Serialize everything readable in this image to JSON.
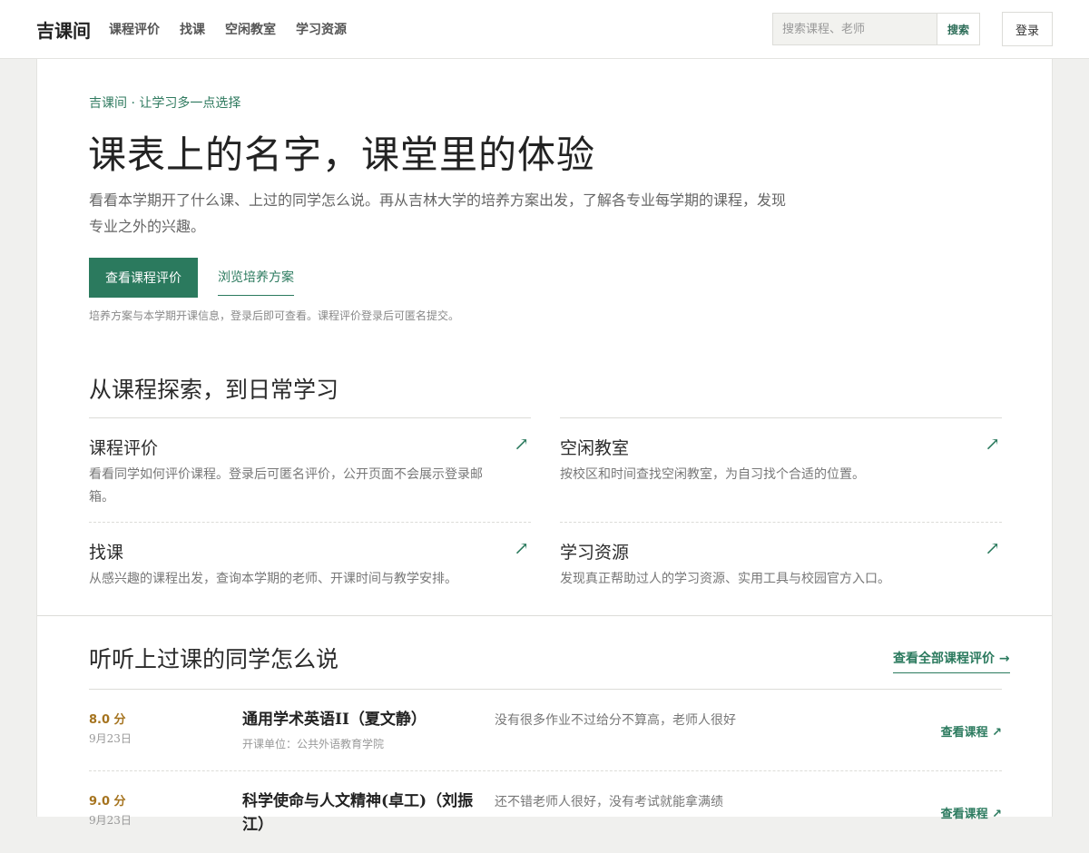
{
  "header": {
    "logo": "吉课间",
    "nav": [
      "课程评价",
      "找课",
      "空闲教室",
      "学习资源"
    ],
    "search_placeholder": "搜索课程、老师",
    "search_button": "搜索",
    "login": "登录"
  },
  "hero": {
    "eyebrow": "吉课间 · 让学习多一点选择",
    "title": "课表上的名字，课堂里的体验",
    "desc": "看看本学期开了什么课、上过的同学怎么说。再从吉林大学的培养方案出发，了解各专业每学期的课程，发现专业之外的兴趣。",
    "primary_button": "查看课程评价",
    "secondary_link": "浏览培养方案",
    "note": "培养方案与本学期开课信息，登录后即可查看。课程评价登录后可匿名提交。"
  },
  "explore": {
    "title": "从课程探索，到日常学习",
    "features": [
      {
        "title": "课程评价",
        "desc": "看看同学如何评价课程。登录后可匿名评价，公开页面不会展示登录邮箱。",
        "arrow": "↗"
      },
      {
        "title": "空闲教室",
        "desc": "按校区和时间查找空闲教室，为自习找个合适的位置。",
        "arrow": "↗"
      },
      {
        "title": "找课",
        "desc": "从感兴趣的课程出发，查询本学期的老师、开课时间与教学安排。",
        "arrow": "↗"
      },
      {
        "title": "学习资源",
        "desc": "发现真正帮助过人的学习资源、实用工具与校园官方入口。",
        "arrow": "↗"
      }
    ]
  },
  "reviews": {
    "title": "听听上过课的同学怎么说",
    "view_all": "查看全部课程评价 →",
    "items": [
      {
        "score": "8.0 分",
        "date": "9月23日",
        "course": "通用学术英语II（夏文静）",
        "unit": "开课单位：公共外语教育学院",
        "comment": "没有很多作业不过给分不算高，老师人很好",
        "view": "查看课程 ↗"
      },
      {
        "score": "9.0 分",
        "date": "9月23日",
        "course": "科学使命与人文精神(卓工)（刘振江）",
        "unit": "",
        "comment": "还不错老师人很好，没有考试就能拿满绩",
        "view": "查看课程 ↗"
      }
    ]
  }
}
